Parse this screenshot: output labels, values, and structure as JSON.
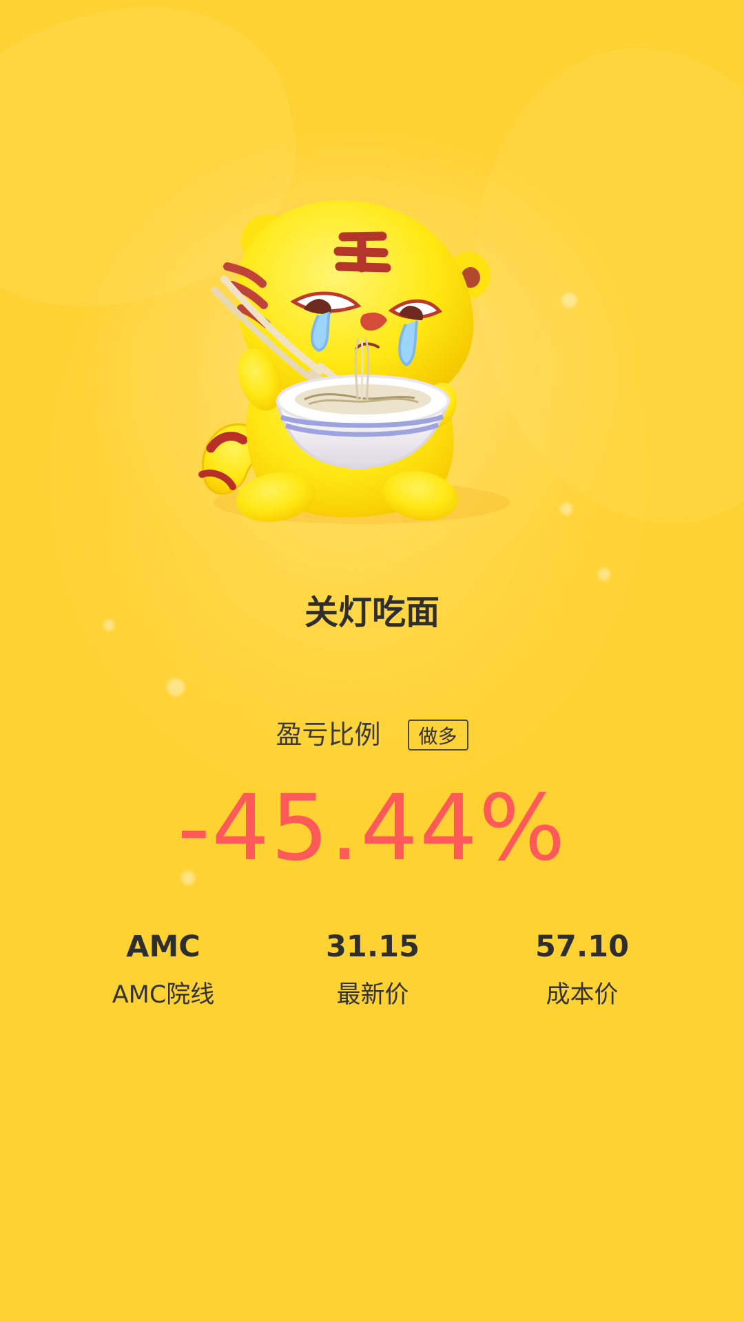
{
  "colors": {
    "background": "#ffd233",
    "accent_negative": "#ff5959",
    "text": "#2e2e2e"
  },
  "mascot": {
    "icon": "crying-tiger-eating-noodles-icon"
  },
  "title": "关灯吃面",
  "ratio": {
    "label": "盈亏比例",
    "position_badge": "做多",
    "value": "-45.44%",
    "numeric_value": -45.44
  },
  "stats": {
    "symbol": {
      "value": "AMC",
      "label": "AMC院线"
    },
    "latest_price": {
      "value": "31.15",
      "label": "最新价"
    },
    "cost_price": {
      "value": "57.10",
      "label": "成本价"
    }
  }
}
